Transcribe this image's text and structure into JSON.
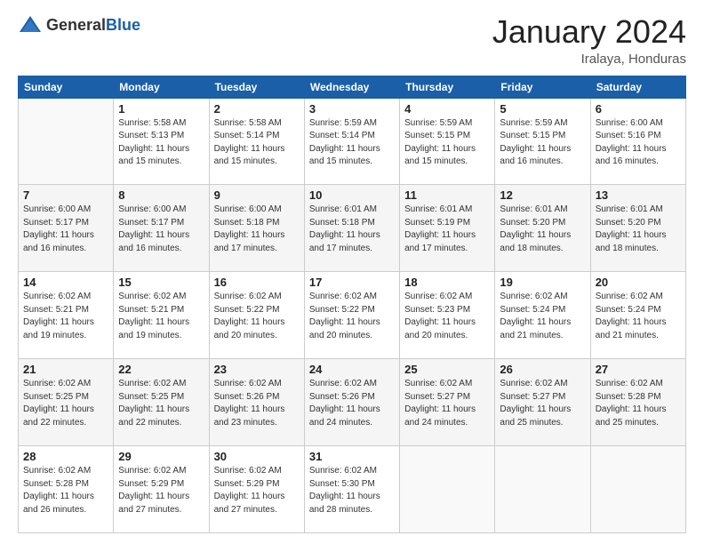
{
  "header": {
    "logo_general": "General",
    "logo_blue": "Blue",
    "month_title": "January 2024",
    "location": "Iralaya, Honduras"
  },
  "days_of_week": [
    "Sunday",
    "Monday",
    "Tuesday",
    "Wednesday",
    "Thursday",
    "Friday",
    "Saturday"
  ],
  "weeks": [
    [
      {
        "day": "",
        "sunrise": "",
        "sunset": "",
        "daylight": ""
      },
      {
        "day": "1",
        "sunrise": "Sunrise: 5:58 AM",
        "sunset": "Sunset: 5:13 PM",
        "daylight": "Daylight: 11 hours and 15 minutes."
      },
      {
        "day": "2",
        "sunrise": "Sunrise: 5:58 AM",
        "sunset": "Sunset: 5:14 PM",
        "daylight": "Daylight: 11 hours and 15 minutes."
      },
      {
        "day": "3",
        "sunrise": "Sunrise: 5:59 AM",
        "sunset": "Sunset: 5:14 PM",
        "daylight": "Daylight: 11 hours and 15 minutes."
      },
      {
        "day": "4",
        "sunrise": "Sunrise: 5:59 AM",
        "sunset": "Sunset: 5:15 PM",
        "daylight": "Daylight: 11 hours and 15 minutes."
      },
      {
        "day": "5",
        "sunrise": "Sunrise: 5:59 AM",
        "sunset": "Sunset: 5:15 PM",
        "daylight": "Daylight: 11 hours and 16 minutes."
      },
      {
        "day": "6",
        "sunrise": "Sunrise: 6:00 AM",
        "sunset": "Sunset: 5:16 PM",
        "daylight": "Daylight: 11 hours and 16 minutes."
      }
    ],
    [
      {
        "day": "7",
        "sunrise": "Sunrise: 6:00 AM",
        "sunset": "Sunset: 5:17 PM",
        "daylight": "Daylight: 11 hours and 16 minutes."
      },
      {
        "day": "8",
        "sunrise": "Sunrise: 6:00 AM",
        "sunset": "Sunset: 5:17 PM",
        "daylight": "Daylight: 11 hours and 16 minutes."
      },
      {
        "day": "9",
        "sunrise": "Sunrise: 6:00 AM",
        "sunset": "Sunset: 5:18 PM",
        "daylight": "Daylight: 11 hours and 17 minutes."
      },
      {
        "day": "10",
        "sunrise": "Sunrise: 6:01 AM",
        "sunset": "Sunset: 5:18 PM",
        "daylight": "Daylight: 11 hours and 17 minutes."
      },
      {
        "day": "11",
        "sunrise": "Sunrise: 6:01 AM",
        "sunset": "Sunset: 5:19 PM",
        "daylight": "Daylight: 11 hours and 17 minutes."
      },
      {
        "day": "12",
        "sunrise": "Sunrise: 6:01 AM",
        "sunset": "Sunset: 5:20 PM",
        "daylight": "Daylight: 11 hours and 18 minutes."
      },
      {
        "day": "13",
        "sunrise": "Sunrise: 6:01 AM",
        "sunset": "Sunset: 5:20 PM",
        "daylight": "Daylight: 11 hours and 18 minutes."
      }
    ],
    [
      {
        "day": "14",
        "sunrise": "Sunrise: 6:02 AM",
        "sunset": "Sunset: 5:21 PM",
        "daylight": "Daylight: 11 hours and 19 minutes."
      },
      {
        "day": "15",
        "sunrise": "Sunrise: 6:02 AM",
        "sunset": "Sunset: 5:21 PM",
        "daylight": "Daylight: 11 hours and 19 minutes."
      },
      {
        "day": "16",
        "sunrise": "Sunrise: 6:02 AM",
        "sunset": "Sunset: 5:22 PM",
        "daylight": "Daylight: 11 hours and 20 minutes."
      },
      {
        "day": "17",
        "sunrise": "Sunrise: 6:02 AM",
        "sunset": "Sunset: 5:22 PM",
        "daylight": "Daylight: 11 hours and 20 minutes."
      },
      {
        "day": "18",
        "sunrise": "Sunrise: 6:02 AM",
        "sunset": "Sunset: 5:23 PM",
        "daylight": "Daylight: 11 hours and 20 minutes."
      },
      {
        "day": "19",
        "sunrise": "Sunrise: 6:02 AM",
        "sunset": "Sunset: 5:24 PM",
        "daylight": "Daylight: 11 hours and 21 minutes."
      },
      {
        "day": "20",
        "sunrise": "Sunrise: 6:02 AM",
        "sunset": "Sunset: 5:24 PM",
        "daylight": "Daylight: 11 hours and 21 minutes."
      }
    ],
    [
      {
        "day": "21",
        "sunrise": "Sunrise: 6:02 AM",
        "sunset": "Sunset: 5:25 PM",
        "daylight": "Daylight: 11 hours and 22 minutes."
      },
      {
        "day": "22",
        "sunrise": "Sunrise: 6:02 AM",
        "sunset": "Sunset: 5:25 PM",
        "daylight": "Daylight: 11 hours and 22 minutes."
      },
      {
        "day": "23",
        "sunrise": "Sunrise: 6:02 AM",
        "sunset": "Sunset: 5:26 PM",
        "daylight": "Daylight: 11 hours and 23 minutes."
      },
      {
        "day": "24",
        "sunrise": "Sunrise: 6:02 AM",
        "sunset": "Sunset: 5:26 PM",
        "daylight": "Daylight: 11 hours and 24 minutes."
      },
      {
        "day": "25",
        "sunrise": "Sunrise: 6:02 AM",
        "sunset": "Sunset: 5:27 PM",
        "daylight": "Daylight: 11 hours and 24 minutes."
      },
      {
        "day": "26",
        "sunrise": "Sunrise: 6:02 AM",
        "sunset": "Sunset: 5:27 PM",
        "daylight": "Daylight: 11 hours and 25 minutes."
      },
      {
        "day": "27",
        "sunrise": "Sunrise: 6:02 AM",
        "sunset": "Sunset: 5:28 PM",
        "daylight": "Daylight: 11 hours and 25 minutes."
      }
    ],
    [
      {
        "day": "28",
        "sunrise": "Sunrise: 6:02 AM",
        "sunset": "Sunset: 5:28 PM",
        "daylight": "Daylight: 11 hours and 26 minutes."
      },
      {
        "day": "29",
        "sunrise": "Sunrise: 6:02 AM",
        "sunset": "Sunset: 5:29 PM",
        "daylight": "Daylight: 11 hours and 27 minutes."
      },
      {
        "day": "30",
        "sunrise": "Sunrise: 6:02 AM",
        "sunset": "Sunset: 5:29 PM",
        "daylight": "Daylight: 11 hours and 27 minutes."
      },
      {
        "day": "31",
        "sunrise": "Sunrise: 6:02 AM",
        "sunset": "Sunset: 5:30 PM",
        "daylight": "Daylight: 11 hours and 28 minutes."
      },
      {
        "day": "",
        "sunrise": "",
        "sunset": "",
        "daylight": ""
      },
      {
        "day": "",
        "sunrise": "",
        "sunset": "",
        "daylight": ""
      },
      {
        "day": "",
        "sunrise": "",
        "sunset": "",
        "daylight": ""
      }
    ]
  ]
}
